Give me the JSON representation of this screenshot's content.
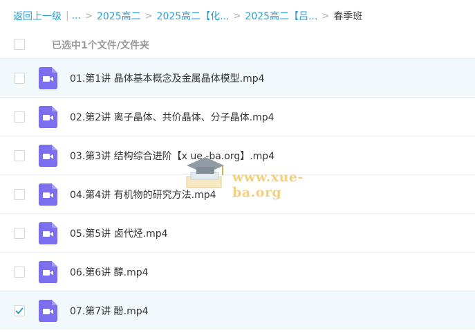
{
  "breadcrumb": {
    "back": "返回上一级",
    "ellipsis": "...",
    "items": [
      "2025高二",
      "2025高二【化...",
      "2025高二【吕..."
    ],
    "current": "春季班"
  },
  "select_all": {
    "label": "已选中1个文件/文件夹",
    "checked": false
  },
  "files": [
    {
      "name": "01.第1讲 晶体基本概念及金属晶体模型.mp4",
      "checked": false,
      "highlighted": true
    },
    {
      "name": "02.第2讲 离子晶体、共价晶体、分子晶体.mp4",
      "checked": false,
      "highlighted": false
    },
    {
      "name": "03.第3讲 结构综合进阶【x ue -ba.org】.mp4",
      "checked": false,
      "highlighted": false
    },
    {
      "name": "04.第4讲 有机物的研究方法.mp4",
      "checked": false,
      "highlighted": false
    },
    {
      "name": "05.第5讲 卤代烃.mp4",
      "checked": false,
      "highlighted": false
    },
    {
      "name": "06.第6讲 醇.mp4",
      "checked": false,
      "highlighted": false
    },
    {
      "name": "07.第7讲 酚.mp4",
      "checked": true,
      "highlighted": true
    }
  ],
  "watermark": {
    "text": "www.xue-ba.org"
  },
  "colors": {
    "link": "#2a9fd6",
    "video_icon": "#7b6ff0",
    "row_highlight": "#f2f9fd",
    "check": "#2a9fd6"
  },
  "icons": {
    "file": "video-file-icon",
    "check": "checkmark-icon"
  }
}
